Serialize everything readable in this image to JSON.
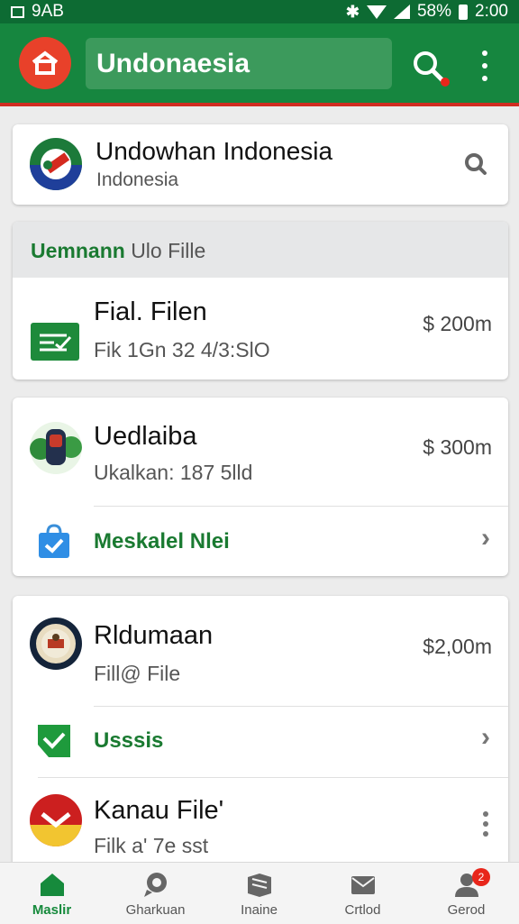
{
  "status_bar": {
    "left_text": "9AB",
    "battery": "58%",
    "time": "2:00"
  },
  "app_bar": {
    "title": "Undonaesia"
  },
  "location_card": {
    "title": "Undowhan Indonesia",
    "subtitle": "Indonesia"
  },
  "file_card": {
    "header_bold": "Uemnann",
    "header_rest": "Ulo Fille",
    "item": {
      "title": "Fial. Filen",
      "subtitle": "Fik 1Gn 32 4/3:SlO",
      "price": "$ 200m"
    }
  },
  "card2": {
    "item": {
      "title": "Uedlaiba",
      "subtitle": "Ukalkan: 187 5lld",
      "price": "$ 300m"
    },
    "action": {
      "label": "Meskalel Nlei"
    }
  },
  "card3": {
    "item": {
      "title": "Rldumaan",
      "subtitle": "Fill@ File",
      "price": "$2,00m"
    },
    "action": {
      "label": "Usssis"
    },
    "item2": {
      "title": "Kanau File'",
      "subtitle": "Filk a' 7e sst"
    }
  },
  "bottom_nav": [
    {
      "label": "Maslir",
      "icon": "home-icon",
      "active": true
    },
    {
      "label": "Gharkuan",
      "icon": "chat-icon",
      "active": false
    },
    {
      "label": "Inaine",
      "icon": "book-icon",
      "active": false
    },
    {
      "label": "Crtlod",
      "icon": "mail-icon",
      "active": false
    },
    {
      "label": "Gerod",
      "icon": "profile-icon",
      "active": false,
      "badge": "2"
    }
  ],
  "colors": {
    "primary": "#16863f",
    "accent_red": "#d12c21",
    "status_bar": "#0d6b33",
    "link_green": "#1a7a31"
  }
}
